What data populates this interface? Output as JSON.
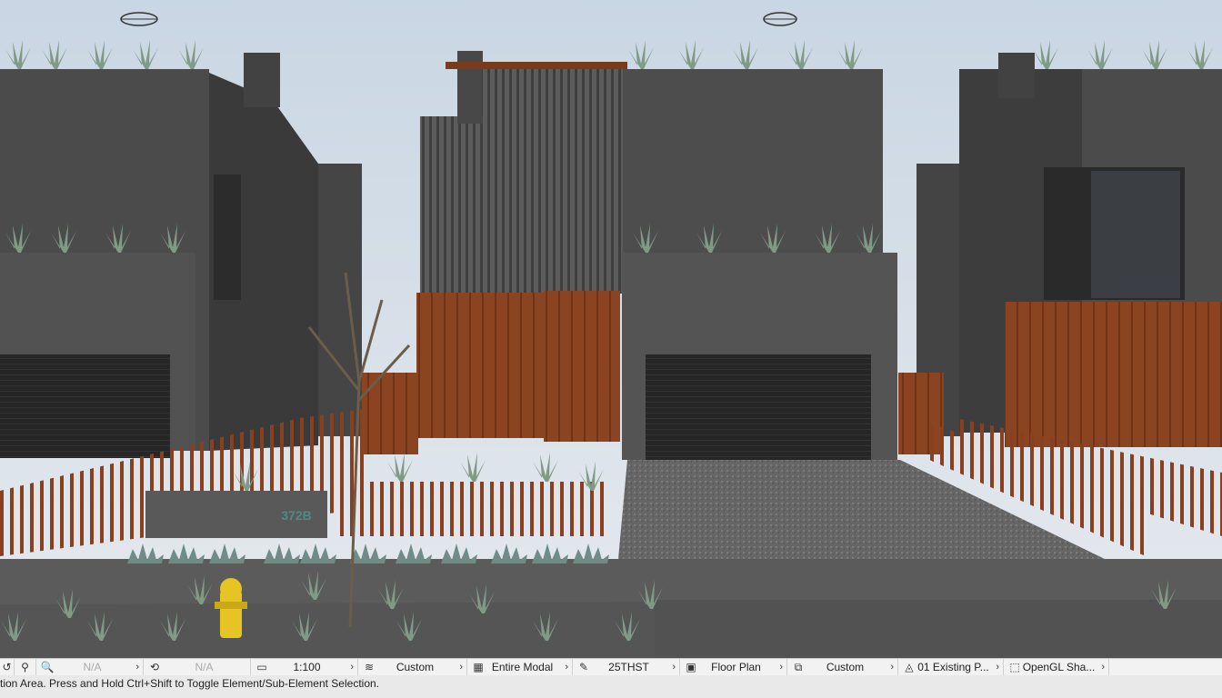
{
  "viewport": {
    "house_number": "372B",
    "colors": {
      "sky": "#d9e3ec",
      "wall": "#4a4a4a",
      "cladding": "#8a3f1e",
      "ground": "#5a5a5a"
    }
  },
  "statusbar": {
    "items": [
      {
        "icon": "undo-icon",
        "glyph": "↺",
        "value": "",
        "dim": false,
        "chevron": false
      },
      {
        "icon": "walk-icon",
        "glyph": "🚶",
        "value": "",
        "dim": false,
        "chevron": false
      },
      {
        "icon": "zoom-icon",
        "glyph": "🔍",
        "value": "N/A",
        "dim": true,
        "chevron": true
      },
      {
        "icon": "rotate-icon",
        "glyph": "⟲",
        "value": "N/A",
        "dim": true,
        "chevron": false
      },
      {
        "icon": "scale-icon",
        "glyph": "▭",
        "value": "1:100",
        "dim": false,
        "chevron": true
      },
      {
        "icon": "layer-combination-icon",
        "glyph": "≋",
        "value": "Custom",
        "dim": false,
        "chevron": true
      },
      {
        "icon": "model-view-icon",
        "glyph": "▦",
        "value": "Entire Modal",
        "dim": false,
        "chevron": true
      },
      {
        "icon": "pen-set-icon",
        "glyph": "✎",
        "value": "25THST",
        "dim": false,
        "chevron": true
      },
      {
        "icon": "floor-plan-icon",
        "glyph": "▣",
        "value": "Floor Plan",
        "dim": false,
        "chevron": true
      },
      {
        "icon": "override-icon",
        "glyph": "⧉",
        "value": "Custom",
        "dim": false,
        "chevron": true
      },
      {
        "icon": "renovation-icon",
        "glyph": "◬",
        "value": "01 Existing P...",
        "dim": false,
        "chevron": true
      },
      {
        "icon": "3d-engine-icon",
        "glyph": "⬚",
        "value": "OpenGL Sha...",
        "dim": false,
        "chevron": true
      }
    ]
  },
  "hint": "ction Area. Press and Hold Ctrl+Shift to Toggle Element/Sub-Element Selection."
}
